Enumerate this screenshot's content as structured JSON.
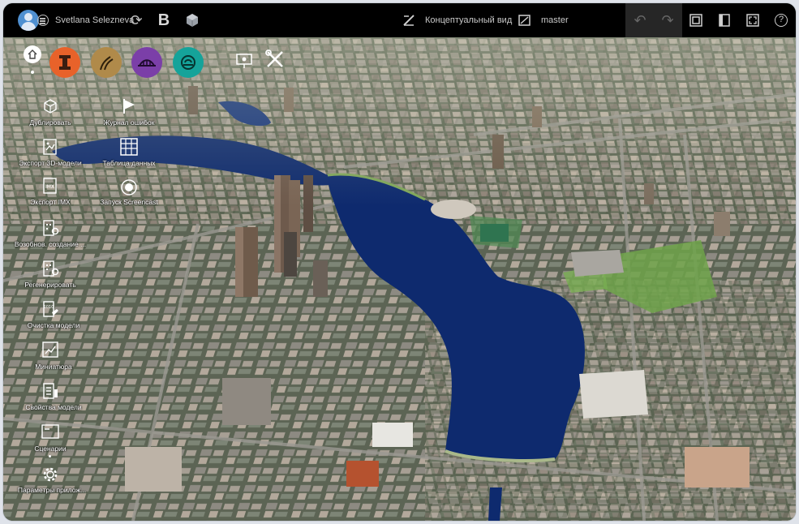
{
  "header": {
    "user_name": "Svetlana Selezneva",
    "view_mode": "Концептуальный вид",
    "branch": "master"
  },
  "colors": {
    "topbar": "#000000",
    "tool_orange": "#e8622a",
    "tool_tan": "#b08a4a",
    "tool_purple": "#7b3fa8",
    "tool_teal": "#15a39a",
    "water": "#0e2a6e"
  },
  "sidebar": {
    "items": [
      {
        "label": "Дублировать",
        "icon": "duplicate-cube-icon"
      },
      {
        "label": "Журнал ошибок",
        "icon": "flag-icon"
      },
      {
        "label": "Экспорт 3D-модели",
        "icon": "export-3d-icon"
      },
      {
        "label": "Таблица данных",
        "icon": "data-table-icon"
      },
      {
        "label": "Экспорт IMX",
        "icon": "export-imx-icon"
      },
      {
        "label": "Запуск Screencast",
        "icon": "screencast-icon"
      },
      {
        "label": "Возобнов. создание ...",
        "icon": "resume-build-icon"
      },
      {
        "label": "Регенерировать",
        "icon": "regenerate-icon"
      },
      {
        "label": "Очистка модели",
        "icon": "clean-model-icon"
      },
      {
        "label": "Миниатюра",
        "icon": "thumbnail-icon"
      },
      {
        "label": "Свойства модели",
        "icon": "model-properties-icon"
      },
      {
        "label": "Сценарии",
        "icon": "scenarios-icon"
      },
      {
        "label": "Параметры прилож...",
        "icon": "app-settings-gear-icon"
      }
    ]
  }
}
